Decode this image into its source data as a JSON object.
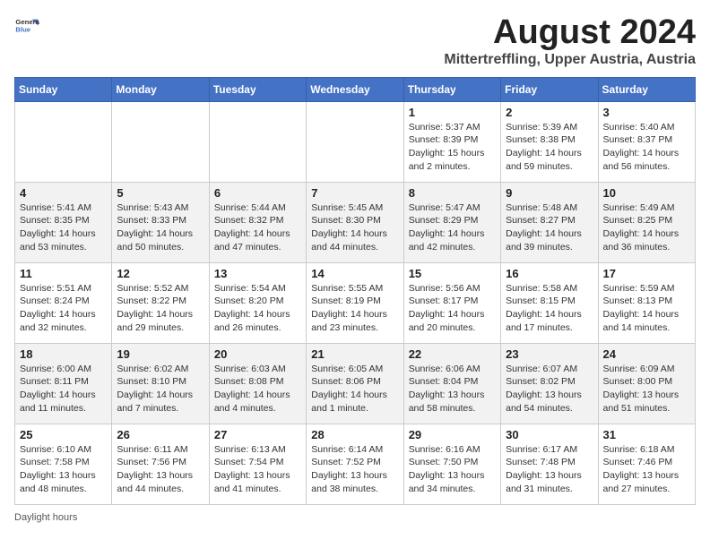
{
  "header": {
    "logo_line1": "General",
    "logo_line2": "Blue",
    "title": "August 2024",
    "subtitle": "Mittertreffling, Upper Austria, Austria"
  },
  "columns": [
    "Sunday",
    "Monday",
    "Tuesday",
    "Wednesday",
    "Thursday",
    "Friday",
    "Saturday"
  ],
  "weeks": [
    [
      {
        "day": "",
        "info": ""
      },
      {
        "day": "",
        "info": ""
      },
      {
        "day": "",
        "info": ""
      },
      {
        "day": "",
        "info": ""
      },
      {
        "day": "1",
        "info": "Sunrise: 5:37 AM\nSunset: 8:39 PM\nDaylight: 15 hours\nand 2 minutes."
      },
      {
        "day": "2",
        "info": "Sunrise: 5:39 AM\nSunset: 8:38 PM\nDaylight: 14 hours\nand 59 minutes."
      },
      {
        "day": "3",
        "info": "Sunrise: 5:40 AM\nSunset: 8:37 PM\nDaylight: 14 hours\nand 56 minutes."
      }
    ],
    [
      {
        "day": "4",
        "info": "Sunrise: 5:41 AM\nSunset: 8:35 PM\nDaylight: 14 hours\nand 53 minutes."
      },
      {
        "day": "5",
        "info": "Sunrise: 5:43 AM\nSunset: 8:33 PM\nDaylight: 14 hours\nand 50 minutes."
      },
      {
        "day": "6",
        "info": "Sunrise: 5:44 AM\nSunset: 8:32 PM\nDaylight: 14 hours\nand 47 minutes."
      },
      {
        "day": "7",
        "info": "Sunrise: 5:45 AM\nSunset: 8:30 PM\nDaylight: 14 hours\nand 44 minutes."
      },
      {
        "day": "8",
        "info": "Sunrise: 5:47 AM\nSunset: 8:29 PM\nDaylight: 14 hours\nand 42 minutes."
      },
      {
        "day": "9",
        "info": "Sunrise: 5:48 AM\nSunset: 8:27 PM\nDaylight: 14 hours\nand 39 minutes."
      },
      {
        "day": "10",
        "info": "Sunrise: 5:49 AM\nSunset: 8:25 PM\nDaylight: 14 hours\nand 36 minutes."
      }
    ],
    [
      {
        "day": "11",
        "info": "Sunrise: 5:51 AM\nSunset: 8:24 PM\nDaylight: 14 hours\nand 32 minutes."
      },
      {
        "day": "12",
        "info": "Sunrise: 5:52 AM\nSunset: 8:22 PM\nDaylight: 14 hours\nand 29 minutes."
      },
      {
        "day": "13",
        "info": "Sunrise: 5:54 AM\nSunset: 8:20 PM\nDaylight: 14 hours\nand 26 minutes."
      },
      {
        "day": "14",
        "info": "Sunrise: 5:55 AM\nSunset: 8:19 PM\nDaylight: 14 hours\nand 23 minutes."
      },
      {
        "day": "15",
        "info": "Sunrise: 5:56 AM\nSunset: 8:17 PM\nDaylight: 14 hours\nand 20 minutes."
      },
      {
        "day": "16",
        "info": "Sunrise: 5:58 AM\nSunset: 8:15 PM\nDaylight: 14 hours\nand 17 minutes."
      },
      {
        "day": "17",
        "info": "Sunrise: 5:59 AM\nSunset: 8:13 PM\nDaylight: 14 hours\nand 14 minutes."
      }
    ],
    [
      {
        "day": "18",
        "info": "Sunrise: 6:00 AM\nSunset: 8:11 PM\nDaylight: 14 hours\nand 11 minutes."
      },
      {
        "day": "19",
        "info": "Sunrise: 6:02 AM\nSunset: 8:10 PM\nDaylight: 14 hours\nand 7 minutes."
      },
      {
        "day": "20",
        "info": "Sunrise: 6:03 AM\nSunset: 8:08 PM\nDaylight: 14 hours\nand 4 minutes."
      },
      {
        "day": "21",
        "info": "Sunrise: 6:05 AM\nSunset: 8:06 PM\nDaylight: 14 hours\nand 1 minute."
      },
      {
        "day": "22",
        "info": "Sunrise: 6:06 AM\nSunset: 8:04 PM\nDaylight: 13 hours\nand 58 minutes."
      },
      {
        "day": "23",
        "info": "Sunrise: 6:07 AM\nSunset: 8:02 PM\nDaylight: 13 hours\nand 54 minutes."
      },
      {
        "day": "24",
        "info": "Sunrise: 6:09 AM\nSunset: 8:00 PM\nDaylight: 13 hours\nand 51 minutes."
      }
    ],
    [
      {
        "day": "25",
        "info": "Sunrise: 6:10 AM\nSunset: 7:58 PM\nDaylight: 13 hours\nand 48 minutes."
      },
      {
        "day": "26",
        "info": "Sunrise: 6:11 AM\nSunset: 7:56 PM\nDaylight: 13 hours\nand 44 minutes."
      },
      {
        "day": "27",
        "info": "Sunrise: 6:13 AM\nSunset: 7:54 PM\nDaylight: 13 hours\nand 41 minutes."
      },
      {
        "day": "28",
        "info": "Sunrise: 6:14 AM\nSunset: 7:52 PM\nDaylight: 13 hours\nand 38 minutes."
      },
      {
        "day": "29",
        "info": "Sunrise: 6:16 AM\nSunset: 7:50 PM\nDaylight: 13 hours\nand 34 minutes."
      },
      {
        "day": "30",
        "info": "Sunrise: 6:17 AM\nSunset: 7:48 PM\nDaylight: 13 hours\nand 31 minutes."
      },
      {
        "day": "31",
        "info": "Sunrise: 6:18 AM\nSunset: 7:46 PM\nDaylight: 13 hours\nand 27 minutes."
      }
    ]
  ],
  "footer": "Daylight hours"
}
